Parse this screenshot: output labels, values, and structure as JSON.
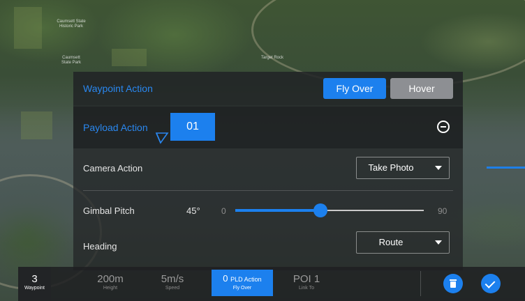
{
  "map": {
    "labels": [
      "Caumsett State Historic Park",
      "Caumsett State Park",
      "Target Rock"
    ]
  },
  "waypoint_action": {
    "label": "Waypoint Action",
    "options": [
      "Fly Over",
      "Hover"
    ],
    "selected": "Fly Over"
  },
  "payload_action": {
    "label": "Payload Action",
    "index": "01"
  },
  "camera_action": {
    "label": "Camera Action",
    "value": "Take Photo"
  },
  "gimbal_pitch": {
    "label": "Gimbal Pitch",
    "value": "45°",
    "min": "0",
    "max": "90",
    "level": 0.45
  },
  "heading": {
    "label": "Heading",
    "value": "Route"
  },
  "bottom_bar": {
    "waypoint": {
      "value": "3",
      "label": "Waypoint"
    },
    "height": {
      "value": "200m",
      "label": "Height"
    },
    "speed": {
      "value": "5m/s",
      "label": "Speed"
    },
    "pld_action": {
      "value": "0",
      "unit": "PLD Action",
      "label": "Fly Over"
    },
    "poi": {
      "value": "POI 1",
      "label": "Link To"
    }
  },
  "colors": {
    "accent": "#1c80ee",
    "secondary_button": "#8d8f93"
  },
  "icons": [
    "minus-circle-icon",
    "gimbal-icon",
    "chevron-down-icon",
    "trash-icon",
    "check-icon"
  ]
}
